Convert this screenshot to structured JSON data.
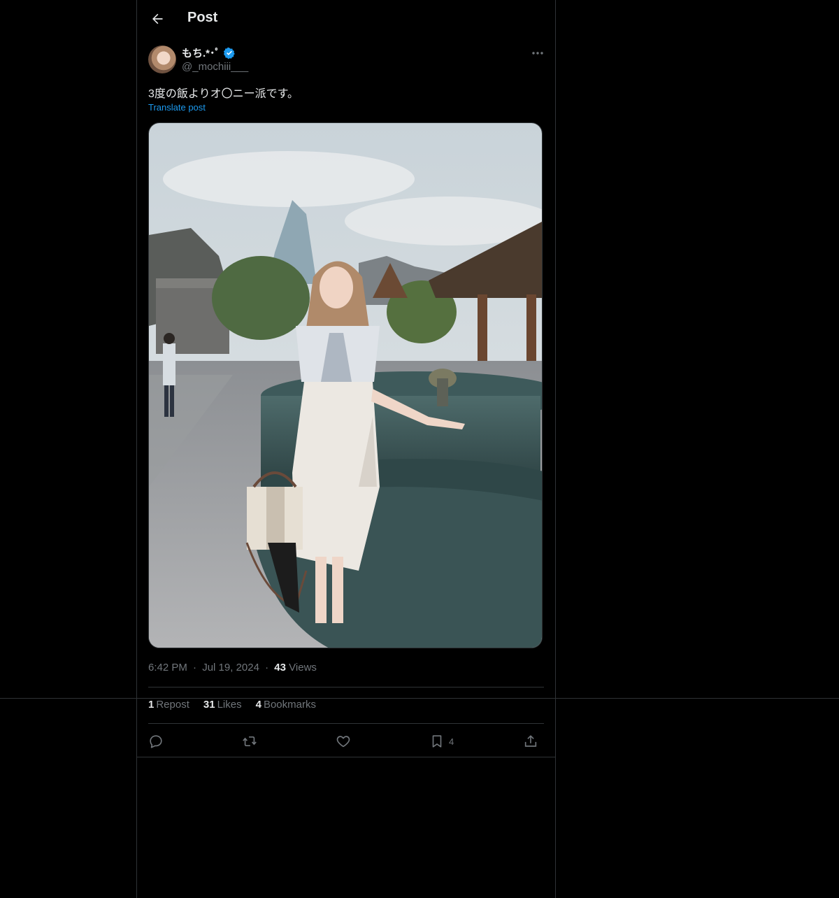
{
  "header": {
    "title": "Post",
    "back_icon": "arrow-left-icon"
  },
  "author": {
    "display_name": "もち.*･ﾟ",
    "handle": "@_mochiii___",
    "verified": true,
    "verified_color": "#1d9bf0"
  },
  "post": {
    "text": "3度の飯よりオ〇ニー派です。",
    "translate_label": "Translate post",
    "time": "6:42 PM",
    "date": "Jul 19, 2024",
    "dot": "·",
    "views_count": "43",
    "views_label": "Views"
  },
  "stats": {
    "reposts_count": "1",
    "reposts_label": "Repost",
    "likes_count": "31",
    "likes_label": "Likes",
    "bookmarks_count": "4",
    "bookmarks_label": "Bookmarks"
  },
  "actions": {
    "reply_icon": "reply-icon",
    "repost_icon": "repost-icon",
    "like_icon": "heart-icon",
    "bookmark_icon": "bookmark-icon",
    "bookmark_count": "4",
    "share_icon": "share-icon"
  },
  "colors": {
    "background": "#000000",
    "text": "#e7e9ea",
    "muted": "#71767b",
    "accent": "#1d9bf0",
    "border": "#2f3336"
  }
}
